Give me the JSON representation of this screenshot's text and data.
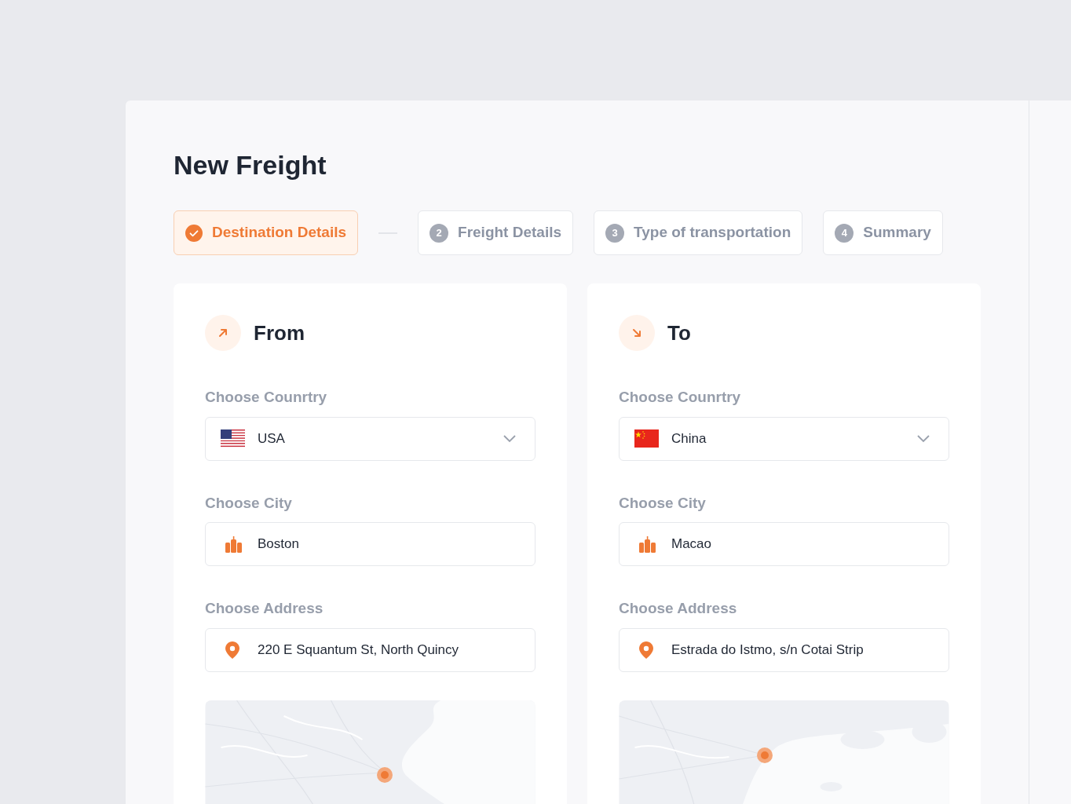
{
  "page": {
    "title": "New Freight"
  },
  "steps": [
    {
      "label": "Destination Details",
      "completed": true,
      "selected": true
    },
    {
      "number": "2",
      "label": "Freight Details",
      "completed": false,
      "selected": false
    },
    {
      "number": "3",
      "label": "Type of transportation",
      "completed": false,
      "selected": false
    },
    {
      "number": "4",
      "label": "Summary",
      "completed": false,
      "selected": false
    }
  ],
  "panels": [
    {
      "title": "From",
      "kind": "outgoing",
      "fields": [
        {
          "kind": "country",
          "label": "Choose Counrtry",
          "value": "USA",
          "flag": {
            "kind": "us"
          }
        },
        {
          "kind": "city",
          "label": "Choose City",
          "value": "Boston"
        },
        {
          "kind": "address",
          "label": "Choose Address",
          "value": "220 E Squantum St, North Quincy"
        }
      ],
      "map": {
        "kind": "picture"
      }
    },
    {
      "title": "To",
      "kind": "incoming",
      "fields": [
        {
          "kind": "country",
          "label": "Choose Counrtry",
          "value": "China",
          "flag": {
            "kind": "cn"
          }
        },
        {
          "kind": "city",
          "label": "Choose City",
          "value": "Macao"
        },
        {
          "kind": "address",
          "label": "Choose Address",
          "value": "Estrada do Istmo, s/n Cotai Strip"
        }
      ],
      "map": {
        "kind": "picture"
      }
    }
  ]
}
